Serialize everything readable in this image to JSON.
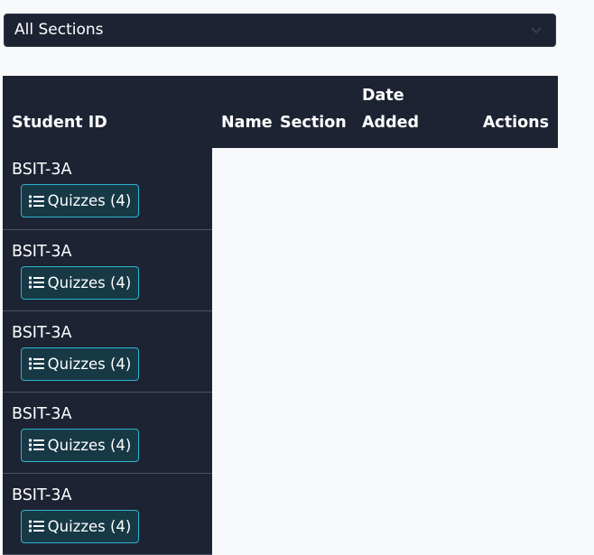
{
  "filter": {
    "selected": "All Sections",
    "chevron_icon": "chevron-down-icon"
  },
  "table": {
    "headers": {
      "student_id": "Student ID",
      "name": "Name",
      "section": "Section",
      "date_added_line1": "Date",
      "date_added_line2": "Added",
      "actions": "Actions"
    },
    "rows": [
      {
        "section": "BSIT-3A",
        "quizzes_label": "Quizzes (4)"
      },
      {
        "section": "BSIT-3A",
        "quizzes_label": "Quizzes (4)"
      },
      {
        "section": "BSIT-3A",
        "quizzes_label": "Quizzes (4)"
      },
      {
        "section": "BSIT-3A",
        "quizzes_label": "Quizzes (4)"
      },
      {
        "section": "BSIT-3A",
        "quizzes_label": "Quizzes (4)"
      }
    ]
  },
  "colors": {
    "page_bg": "#f8f9fb",
    "dark_surface": "#1d2333",
    "button_bg": "#173845",
    "button_border": "#2cb5ce"
  }
}
